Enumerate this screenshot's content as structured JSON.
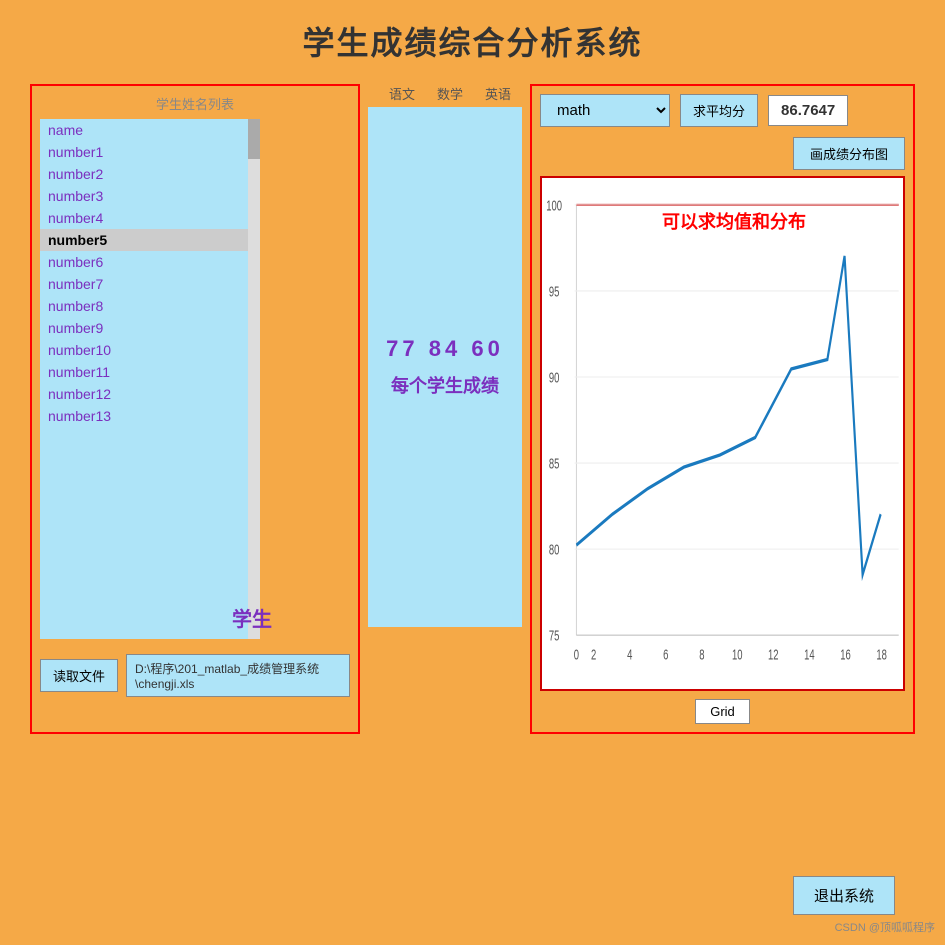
{
  "title": "学生成绩综合分析系统",
  "left_panel": {
    "title": "学生姓名列表",
    "student_label": "学生",
    "students": [
      "name",
      "number1",
      "number2",
      "number3",
      "number4",
      "number5",
      "number6",
      "number7",
      "number8",
      "number9",
      "number10",
      "number11",
      "number12",
      "number13"
    ],
    "selected_index": 5,
    "read_file_label": "读取文件",
    "file_path": "D:\\程序\\201_matlab_成绩管理系统\\chengji.xls"
  },
  "middle_panel": {
    "headers": [
      "语文",
      "数学",
      "英语"
    ],
    "scores": "77  84  60",
    "label": "每个学生成绩"
  },
  "right_panel": {
    "subject_value": "math",
    "avg_btn_label": "求平均分",
    "avg_value": "86.7647",
    "chart_btn_label": "画成绩分布图",
    "chart_annotation": "可以求均值和分布",
    "grid_btn_label": "Grid",
    "exit_btn_label": "退出系统"
  },
  "chart": {
    "x_labels": [
      "0",
      "2",
      "4",
      "6",
      "8",
      "10",
      "12",
      "14",
      "16",
      "18"
    ],
    "y_labels": [
      "75",
      "80",
      "85",
      "90",
      "95",
      "100"
    ],
    "line_points": [
      {
        "x": 0,
        "y": 80.2
      },
      {
        "x": 2,
        "y": 82.0
      },
      {
        "x": 4,
        "y": 83.5
      },
      {
        "x": 6,
        "y": 84.8
      },
      {
        "x": 8,
        "y": 85.5
      },
      {
        "x": 10,
        "y": 86.5
      },
      {
        "x": 12,
        "y": 90.5
      },
      {
        "x": 14,
        "y": 91.0
      },
      {
        "x": 15,
        "y": 97.0
      },
      {
        "x": 16,
        "y": 78.5
      },
      {
        "x": 17,
        "y": 82.0
      }
    ]
  },
  "watermark": "CSDN @顶呱呱程序"
}
